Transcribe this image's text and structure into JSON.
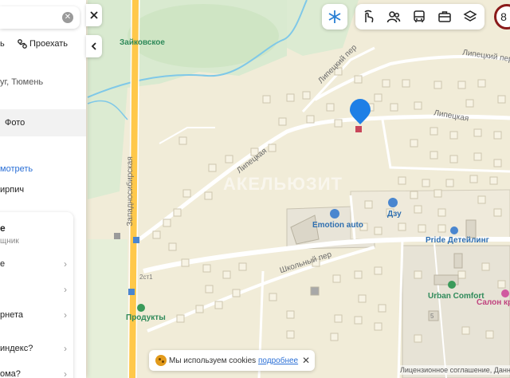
{
  "search": {
    "query": "",
    "clear_icon": "close-circle-icon"
  },
  "route": {
    "partial_label": "ь",
    "drive_label": "Проехать",
    "drive_icon": "route-icon"
  },
  "place": {
    "address_fragment": "уг, Тюмень",
    "photo_label": "Фото",
    "show_link": "мотреть",
    "brick_text": "ирпич"
  },
  "card": {
    "title": "е",
    "subtitle": "щник",
    "items": [
      {
        "label": "е"
      },
      {
        "label": ""
      },
      {
        "label": "рнета"
      },
      {
        "label": "индекс?"
      },
      {
        "label": "ома?"
      }
    ]
  },
  "map": {
    "streets": {
      "lipetsky_lane_top": "Липецкий пер",
      "lipetsky_lane_right": "Липецкий пер",
      "lipetskaya_right": "Липецкая",
      "lipetskaya_left": "Липецкая",
      "zapadnosibirskaya": "Западносибирская",
      "shkolny_lane": "Школьный пер"
    },
    "places": {
      "zaikovskoe": "Зайковское",
      "emotion_auto": "Emotion auto",
      "dzu": "Дзу",
      "pride_detailing": "Pride Детейлинг",
      "urban_comfort": "Urban Comfort",
      "salon_krasoty": "Салон красо",
      "produkty": "Продукты"
    },
    "house_numbers": {
      "h2s1": "2ст1",
      "h5": "5"
    },
    "watermark": "АКЕЛЬЮЗИТ",
    "marker_icon": "location-pin-icon"
  },
  "controls": {
    "snow_icon": "snowflake-icon",
    "transport_icons": [
      "hand-pointer-icon",
      "people-icon",
      "bus-icon",
      "briefcase-icon",
      "layers-icon"
    ],
    "zoom_badge": "8",
    "collapse_icon": "chevron-left-icon",
    "close_icon": "close-icon"
  },
  "cookie": {
    "text": "Мы используем cookies",
    "link": "подробнее",
    "close": "✕"
  },
  "license": "Лицензионное соглашение, Данны",
  "colors": {
    "map_bg": "#f1ecd8",
    "road_main": "#ffc84a",
    "marker": "#1e7fe6",
    "link": "#2a6fd6"
  }
}
